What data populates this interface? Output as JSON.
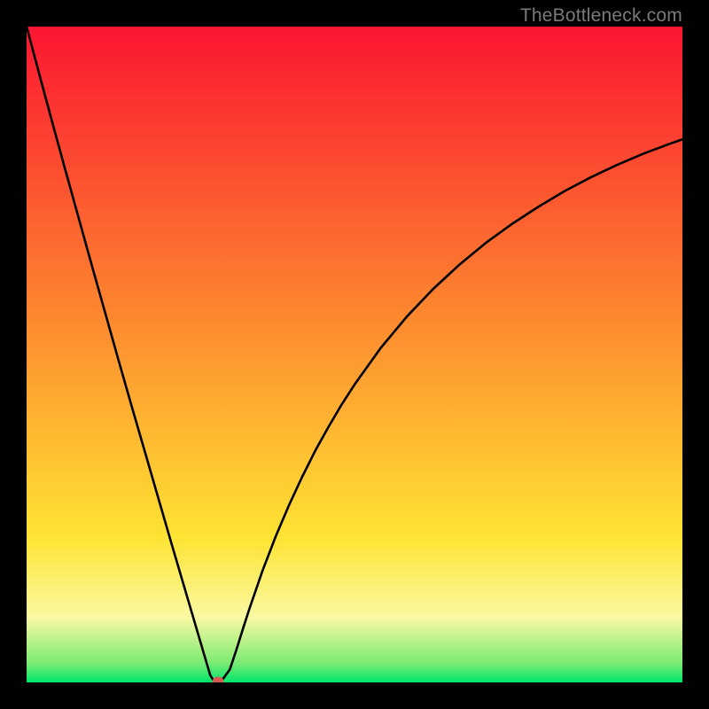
{
  "watermark": "TheBottleneck.com",
  "colors": {
    "top": "#fb1531",
    "mid1": "#fd8a2f",
    "mid2": "#fee433",
    "band_light": "#fbf9a2",
    "green1": "#7deb73",
    "green2": "#00e66b",
    "curve": "#000000",
    "marker": "#d45a52"
  },
  "chart_data": {
    "type": "line",
    "title": "",
    "xlabel": "",
    "ylabel": "",
    "xlim": [
      0,
      100
    ],
    "ylim": [
      0,
      100
    ],
    "x": [
      0,
      2,
      4,
      6,
      8,
      10,
      12,
      14,
      16,
      18,
      20,
      22,
      24,
      26,
      27,
      27.5,
      28,
      28.5,
      29,
      30,
      31,
      32,
      33,
      34,
      36,
      38,
      40,
      42,
      44,
      46,
      48,
      50,
      54,
      58,
      62,
      66,
      70,
      74,
      78,
      82,
      86,
      90,
      94,
      98,
      100
    ],
    "values": [
      100,
      92.5,
      85.1,
      77.8,
      70.6,
      63.4,
      56.3,
      49.2,
      42.2,
      35.3,
      28.4,
      21.5,
      14.7,
      7.9,
      4.5,
      2.8,
      1.1,
      0.3,
      0.2,
      0.6,
      2.0,
      5.0,
      8.2,
      11.3,
      17.1,
      22.3,
      27.0,
      31.3,
      35.3,
      38.9,
      42.3,
      45.4,
      51.0,
      55.8,
      60.0,
      63.7,
      67.0,
      69.9,
      72.5,
      74.9,
      77.0,
      78.9,
      80.6,
      82.1,
      82.8
    ],
    "marker": {
      "x": 29.2,
      "y": 0.2
    }
  }
}
